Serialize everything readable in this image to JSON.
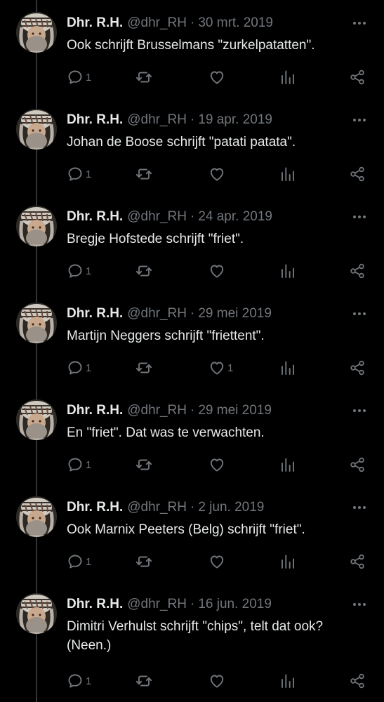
{
  "colors": {
    "background": "#000000",
    "text": "#e7e9ea",
    "muted": "#71767b",
    "thread_line": "#333639"
  },
  "icons": {
    "reply": "speech-bubble-icon",
    "retweet": "retweet-arrows-icon",
    "like": "heart-icon",
    "views": "bar-chart-icon",
    "share": "share-nodes-icon",
    "more": "ellipsis-icon"
  },
  "tweets": [
    {
      "name": "Dhr. R.H.",
      "handle": "@dhr_RH",
      "separator": "·",
      "date": "30 mrt. 2019",
      "text": "Ook schrijft Brusselmans \"zurkelpatatten\".",
      "replies": "1",
      "retweets": "",
      "likes": ""
    },
    {
      "name": "Dhr. R.H.",
      "handle": "@dhr_RH",
      "separator": "·",
      "date": "19 apr. 2019",
      "text": "Johan de Boose schrijft \"patati patata\".",
      "replies": "1",
      "retweets": "",
      "likes": ""
    },
    {
      "name": "Dhr. R.H.",
      "handle": "@dhr_RH",
      "separator": "·",
      "date": "24 apr. 2019",
      "text": "Bregje Hofstede schrijft \"friet\".",
      "replies": "1",
      "retweets": "",
      "likes": ""
    },
    {
      "name": "Dhr. R.H.",
      "handle": "@dhr_RH",
      "separator": "·",
      "date": "29 mei 2019",
      "text": "Martijn Neggers schrijft \"friettent\".",
      "replies": "1",
      "retweets": "",
      "likes": "1"
    },
    {
      "name": "Dhr. R.H.",
      "handle": "@dhr_RH",
      "separator": "·",
      "date": "29 mei 2019",
      "text": "En \"friet\". Dat was te verwachten.",
      "replies": "1",
      "retweets": "",
      "likes": ""
    },
    {
      "name": "Dhr. R.H.",
      "handle": "@dhr_RH",
      "separator": "·",
      "date": "2 jun. 2019",
      "text": "Ook Marnix Peeters (Belg) schrijft \"friet\".",
      "replies": "1",
      "retweets": "",
      "likes": ""
    },
    {
      "name": "Dhr. R.H.",
      "handle": "@dhr_RH",
      "separator": "·",
      "date": "16 jun. 2019",
      "text": "Dimitri Verhulst schrijft \"chips\", telt dat ook? (Neen.)",
      "replies": "1",
      "retweets": "",
      "likes": ""
    }
  ]
}
